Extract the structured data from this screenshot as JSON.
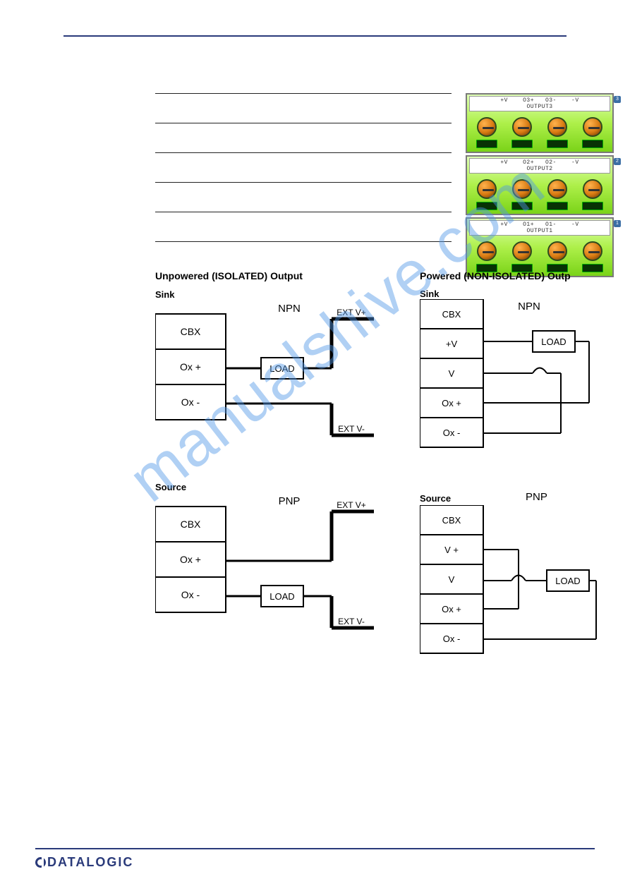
{
  "connector": {
    "rows": [
      {
        "label": "+V    O3+   O3-    -V",
        "name": "OUTPUT3",
        "tag": "3"
      },
      {
        "label": "+V    O2+   O2-    -V",
        "name": "OUTPUT2",
        "tag": "2"
      },
      {
        "label": "+V    O1+   O1-    -V",
        "name": "OUTPUT1",
        "tag": "1"
      }
    ]
  },
  "diagrams": {
    "left_title": "Unpowered (ISOLATED) Output",
    "right_title": "Powered (NON-ISOLATED)  Outp",
    "sink_label": "Sink",
    "source_label": "Source",
    "npn_label": "NPN",
    "pnp_label": "PNP",
    "cbx": "CBX",
    "oxp": "Ox +",
    "oxm": "Ox -",
    "load": "LOAD",
    "ext_vp": "EXT  V+",
    "ext_vm": "EXT  V-",
    "pv": "+V",
    "v": "V",
    "vp": "V +"
  },
  "watermark": "manualshive.com",
  "brand": "DATALOGIC"
}
